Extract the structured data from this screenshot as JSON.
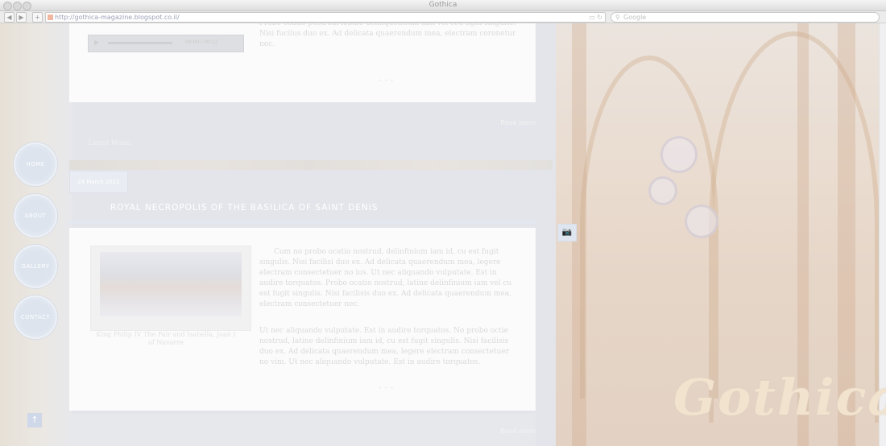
{
  "browser": {
    "window_title": "Gothica",
    "url": "http://gothica-magazine.blogspot.co.il/",
    "search_placeholder": "Google",
    "back": "◀",
    "forward": "▶",
    "add_tab": "+"
  },
  "nav": {
    "home": "HOME",
    "about": "ABOUT",
    "gallery": "GALLERY",
    "contact": "CONTACT",
    "to_top": "↑"
  },
  "post_top": {
    "audio_time": "00:00 / 00:12",
    "text": "Probo ocatio postrudi lobme delinquentium iam vel ceu ligni singulte. Nisi fucilus duo ex. Ad delicata quaerendum mea, electram coronetur nec."
  },
  "read_more_1": "Read more",
  "section_label": "Latest Music",
  "post": {
    "date": "24 March 2011",
    "title": "ROYAL NECROPOLIS OF THE BASILICA OF SAINT DENIS",
    "caption": "King Philip IV The Fair and Isabella, Joan I of Navarre",
    "paragraph_1": "Cum no probo ocatio nostrud, delinfinium iam id, cu est fugit singulis. Nisi facilisi duo ex. Ad delicata quaerendum mea, legere electram consectetuer no ius. Ut nec aliquando vulputate. Est in audire torquatos. Probo ocatio nostrud, latine delinfinium iam vel cu est fugit singulis. Nisi facilisis duo ex. Ad delicata quaerendum mea, electram consectetuer nec.",
    "paragraph_2": "Ut nec aliquando vulputate. Est in audire torquatos. No probo octie nostrud, latine delinfinium iam id, cu est fugit singulis. Nisi facilisis duo ex. Ad delicata quaerendum mea, legere electram consectetuer no vim. Ut nec aliquando vulputate. Est in audire torquatos."
  },
  "read_more_2": "Read more",
  "logo": "Gothica",
  "icons": {
    "camera": "📷",
    "play": "▶",
    "search": "🔍"
  }
}
